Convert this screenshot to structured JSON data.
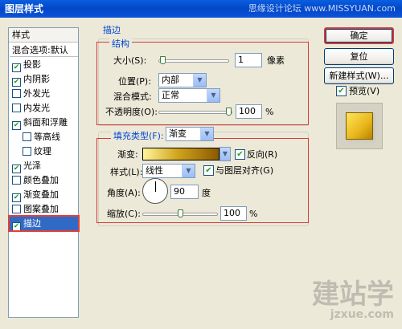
{
  "window": {
    "title": "图层样式",
    "watermark": "思缘设计论坛 www.MISSYUAN.com"
  },
  "styles_panel": {
    "header": "样式",
    "items": [
      {
        "label": "混合选项:默认",
        "checkbox": false,
        "checked": false
      },
      {
        "label": "投影",
        "checkbox": true,
        "checked": true
      },
      {
        "label": "内阴影",
        "checkbox": true,
        "checked": true
      },
      {
        "label": "外发光",
        "checkbox": true,
        "checked": false
      },
      {
        "label": "内发光",
        "checkbox": true,
        "checked": false
      },
      {
        "label": "斜面和浮雕",
        "checkbox": true,
        "checked": true
      },
      {
        "label": "等高线",
        "checkbox": true,
        "checked": false
      },
      {
        "label": "纹理",
        "checkbox": true,
        "checked": false
      },
      {
        "label": "光泽",
        "checkbox": true,
        "checked": true
      },
      {
        "label": "颜色叠加",
        "checkbox": true,
        "checked": false
      },
      {
        "label": "渐变叠加",
        "checkbox": true,
        "checked": true
      },
      {
        "label": "图案叠加",
        "checkbox": true,
        "checked": false
      },
      {
        "label": "描边",
        "checkbox": true,
        "checked": true,
        "selected": true
      }
    ]
  },
  "stroke": {
    "title": "描边",
    "structure": {
      "title": "结构",
      "size_label": "大小(S):",
      "size_value": "1",
      "size_unit": "像素",
      "size_slider_fraction": 0.01,
      "position_label": "位置(P):",
      "position_value": "内部",
      "blend_mode_label": "混合模式:",
      "blend_mode_value": "正常",
      "opacity_label": "不透明度(O):",
      "opacity_value": "100",
      "opacity_unit": "%",
      "opacity_slider_fraction": 1.0
    },
    "fill": {
      "fill_type_label": "填充类型(F):",
      "fill_type_value": "渐变",
      "gradient_label": "渐变:",
      "gradient_colors": [
        "#fff59a",
        "#d1a51f",
        "#8a5a00"
      ],
      "reverse_label": "反向(R)",
      "reverse_checked": true,
      "style_label": "样式(L):",
      "style_value": "线性",
      "align_label": "与图层对齐(G)",
      "align_checked": true,
      "angle_label": "角度(A):",
      "angle_value": "90",
      "angle_unit": "度",
      "scale_label": "缩放(C):",
      "scale_value": "100",
      "scale_unit": "%",
      "scale_slider_fraction": 0.5
    }
  },
  "buttons": {
    "ok": "确定",
    "reset": "复位",
    "new_style": "新建样式(W)...",
    "preview_label": "预览(V)",
    "preview_checked": true
  },
  "footer_logo": {
    "text": "建站学",
    "url": "jzxue.com"
  },
  "colors": {
    "accent": "#0046d5",
    "highlight_frame": "#d23a3a",
    "selection": "#316ac5"
  }
}
